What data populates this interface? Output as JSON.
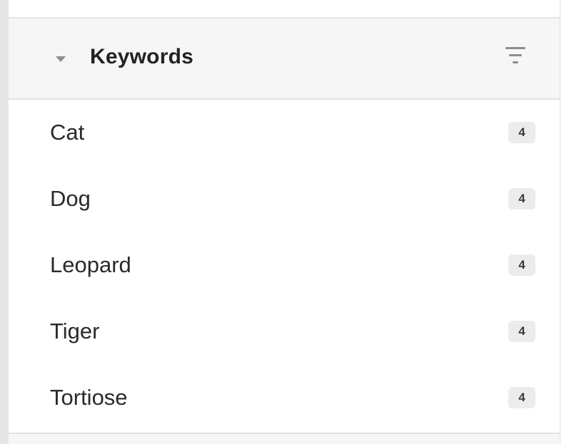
{
  "section": {
    "title": "Keywords",
    "expanded": true,
    "caret_icon": "caret-down-icon",
    "filter_icon": "filter-icon"
  },
  "keywords": [
    {
      "label": "Cat",
      "count": "4"
    },
    {
      "label": "Dog",
      "count": "4"
    },
    {
      "label": "Leopard",
      "count": "4"
    },
    {
      "label": "Tiger",
      "count": "4"
    },
    {
      "label": "Tortiose",
      "count": "4"
    }
  ],
  "colors": {
    "header_bg": "#f6f6f6",
    "badge_bg": "#ececec",
    "text": "#2a2a2a",
    "icon": "#8d8d8d"
  }
}
